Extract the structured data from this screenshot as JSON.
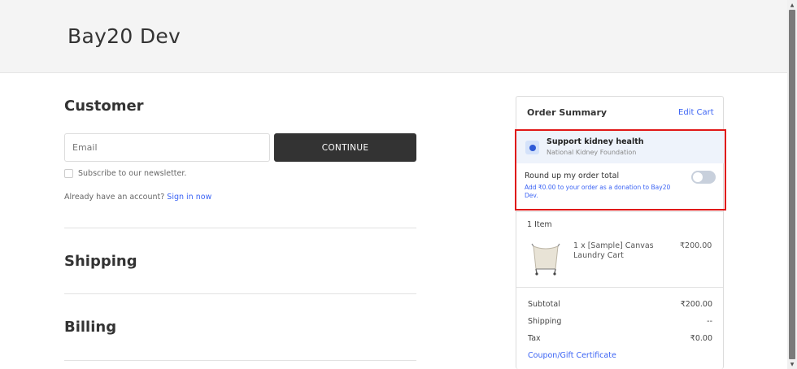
{
  "header": {
    "store_name": "Bay20 Dev"
  },
  "customer": {
    "title": "Customer",
    "email_placeholder": "Email",
    "continue_label": "CONTINUE",
    "newsletter_label": "Subscribe to our newsletter.",
    "account_text": "Already have an account?",
    "sign_in_label": "Sign in now"
  },
  "shipping": {
    "title": "Shipping"
  },
  "billing": {
    "title": "Billing"
  },
  "summary": {
    "title": "Order Summary",
    "edit_cart_label": "Edit Cart",
    "charity": {
      "name": "Support kidney health",
      "org": "National Kidney Foundation",
      "roundup_title": "Round up my order total",
      "roundup_desc": "Add ₹0.00 to your order as a donation to Bay20 Dev.",
      "toggle_on": false,
      "icon": "charity-icon"
    },
    "items_count": "1 Item",
    "product": {
      "name": "1 x [Sample] Canvas Laundry Cart",
      "price": "₹200.00"
    },
    "rows": {
      "subtotal_label": "Subtotal",
      "subtotal_value": "₹200.00",
      "shipping_label": "Shipping",
      "shipping_value": "--",
      "tax_label": "Tax",
      "tax_value": "₹0.00"
    },
    "coupon_label": "Coupon/Gift Certificate"
  },
  "colors": {
    "accent_link": "#3c64f4",
    "button_dark": "#333333",
    "highlight_red": "#e01818"
  }
}
